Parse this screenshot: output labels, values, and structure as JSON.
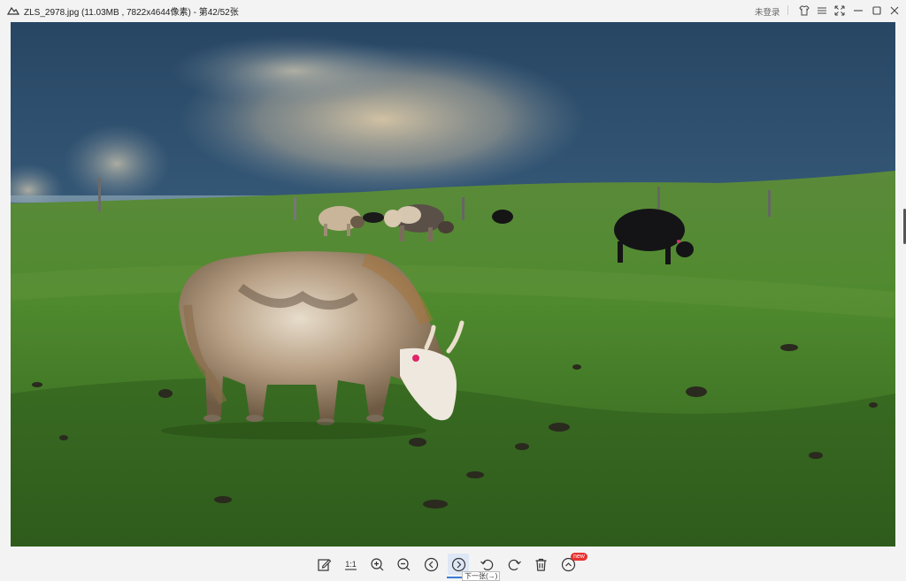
{
  "window": {
    "title": "ZLS_2978.jpg (11.03MB , 7822x4644像素) - 第42/52张",
    "login_label": "未登录",
    "controls": [
      "skin-icon",
      "menu-icon",
      "fullscreen-icon",
      "minimize-icon",
      "maximize-icon",
      "close-icon"
    ]
  },
  "toolbar": {
    "tools": [
      {
        "name": "edit-icon"
      },
      {
        "name": "actual-size-icon",
        "label": "1:1"
      },
      {
        "name": "zoom-in-icon"
      },
      {
        "name": "zoom-out-icon"
      },
      {
        "name": "previous-icon"
      },
      {
        "name": "next-icon",
        "active": true
      },
      {
        "name": "rotate-left-icon"
      },
      {
        "name": "rotate-right-icon"
      },
      {
        "name": "delete-icon"
      },
      {
        "name": "more-icon"
      }
    ],
    "badge": "new",
    "tooltip": "下一张(→)"
  },
  "colors": {
    "accent": "#3a7bd5",
    "badge": "#e8322f"
  }
}
